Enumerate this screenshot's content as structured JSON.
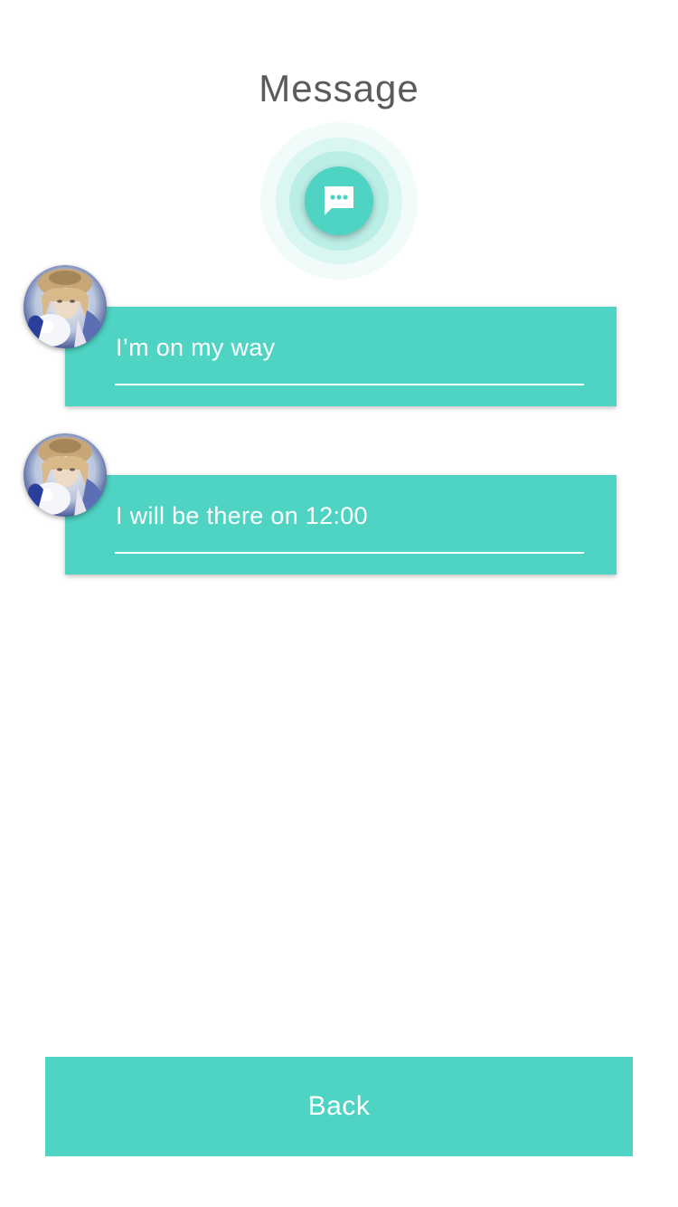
{
  "header": {
    "title": "Message",
    "icon": "chat-bubble-icon"
  },
  "messages": [
    {
      "text": "I’m on my way",
      "avatar": "user-avatar"
    },
    {
      "text": "I will be there on 12:00",
      "avatar": "user-avatar"
    }
  ],
  "footer": {
    "back_label": "Back"
  },
  "colors": {
    "accent": "#4fd3c2",
    "title": "#5b5b5b",
    "background": "#ffffff"
  }
}
